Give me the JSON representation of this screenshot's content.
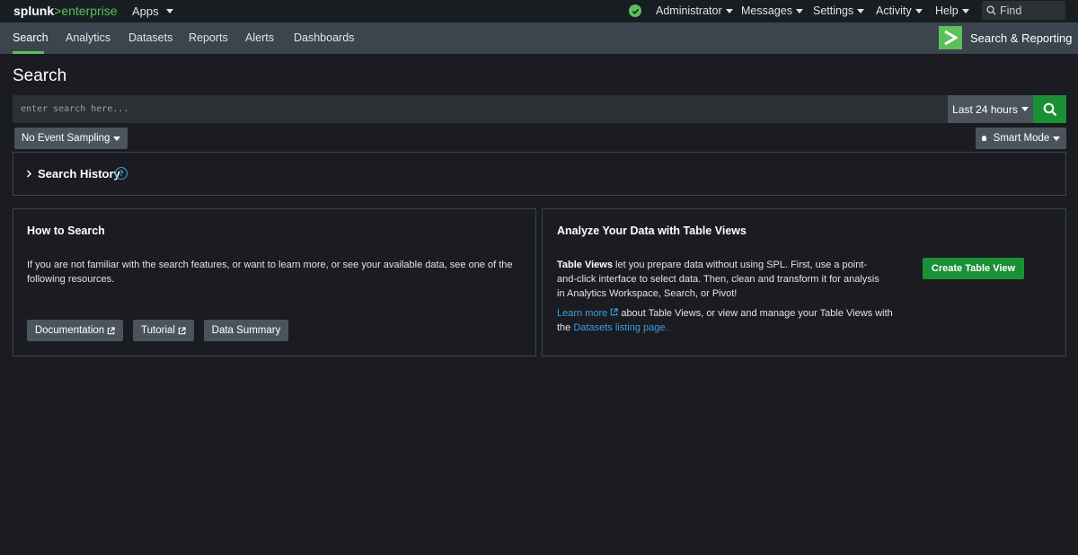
{
  "topbar": {
    "brand": {
      "splunk": "splunk",
      "arrow": ">",
      "product": "enterprise"
    },
    "apps_label": "Apps",
    "status_icon": "check-circle-icon",
    "menus": [
      "Administrator",
      "Messages",
      "Settings",
      "Activity",
      "Help"
    ],
    "find_placeholder": "Find"
  },
  "appbar": {
    "tabs": [
      "Search",
      "Analytics",
      "Datasets",
      "Reports",
      "Alerts",
      "Dashboards"
    ],
    "active_tab": "Search",
    "app_name": "Search & Reporting",
    "accent_color": "#5cc05c"
  },
  "search": {
    "page_title": "Search",
    "placeholder": "enter search here...",
    "time_range": "Last 24 hours",
    "sampling": "No Event Sampling",
    "mode": "Smart Mode"
  },
  "history": {
    "title": "Search History"
  },
  "howto": {
    "title": "How to Search",
    "text": "If you are not familiar with the search features, or want to learn more, or see your available data, see one of the following resources.",
    "buttons": {
      "documentation": "Documentation",
      "tutorial": "Tutorial",
      "data_summary": "Data Summary"
    }
  },
  "tableviews": {
    "title": "Analyze Your Data with Table Views",
    "text_bold": "Table Views",
    "text_rest": " let you prepare data without using SPL. First, use a point-and-click interface to select data. Then, clean and transform it for analysis in Analytics Workspace, Search, or Pivot!",
    "learn_more": "Learn more",
    "links_mid": " about Table Views, or view and manage your Table Views with the ",
    "datasets_link": "Datasets listing page.",
    "create_button": "Create Table View"
  },
  "colors": {
    "primary_green": "#1a9035",
    "link_blue": "#3aa0e0"
  }
}
